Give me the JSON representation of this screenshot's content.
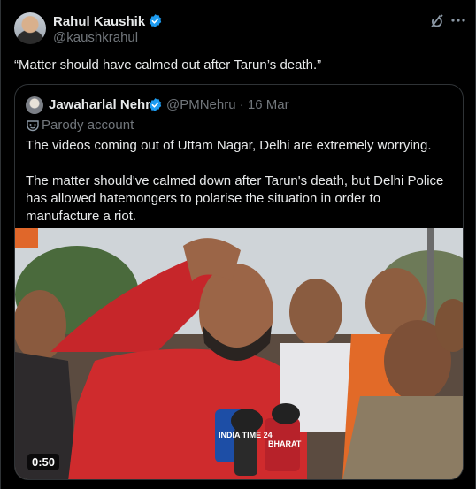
{
  "author": {
    "name": "Rahul Kaushik",
    "handle": "@kaushkrahul"
  },
  "tweet": {
    "text": "“Matter should have calmed out after Tarun’s death.”"
  },
  "quoted": {
    "name": "Jawaharlal Nehru",
    "handle": "@PMNehru",
    "date": "· 16 Mar",
    "label": "Parody account",
    "paragraph1": "The videos coming out of Uttam Nagar, Delhi are extremely worrying.",
    "paragraph2": "The matter should've calmed down after Tarun's death, but Delhi Police has allowed hatemongers to polarise the situation in order to manufacture a riot.",
    "ellipsis": "...",
    "video": {
      "duration": "0:50",
      "mic_label_1": "INDIA TIME 24",
      "mic_label_2": "BHARAT"
    }
  },
  "colors": {
    "background": "#000000",
    "text": "#e7e9ea",
    "muted": "#71767b",
    "verified": "#1d9bf0",
    "border": "#2f3336"
  },
  "icons": [
    "verified-badge-icon",
    "grok-icon",
    "more-icon",
    "parody-mask-icon"
  ]
}
